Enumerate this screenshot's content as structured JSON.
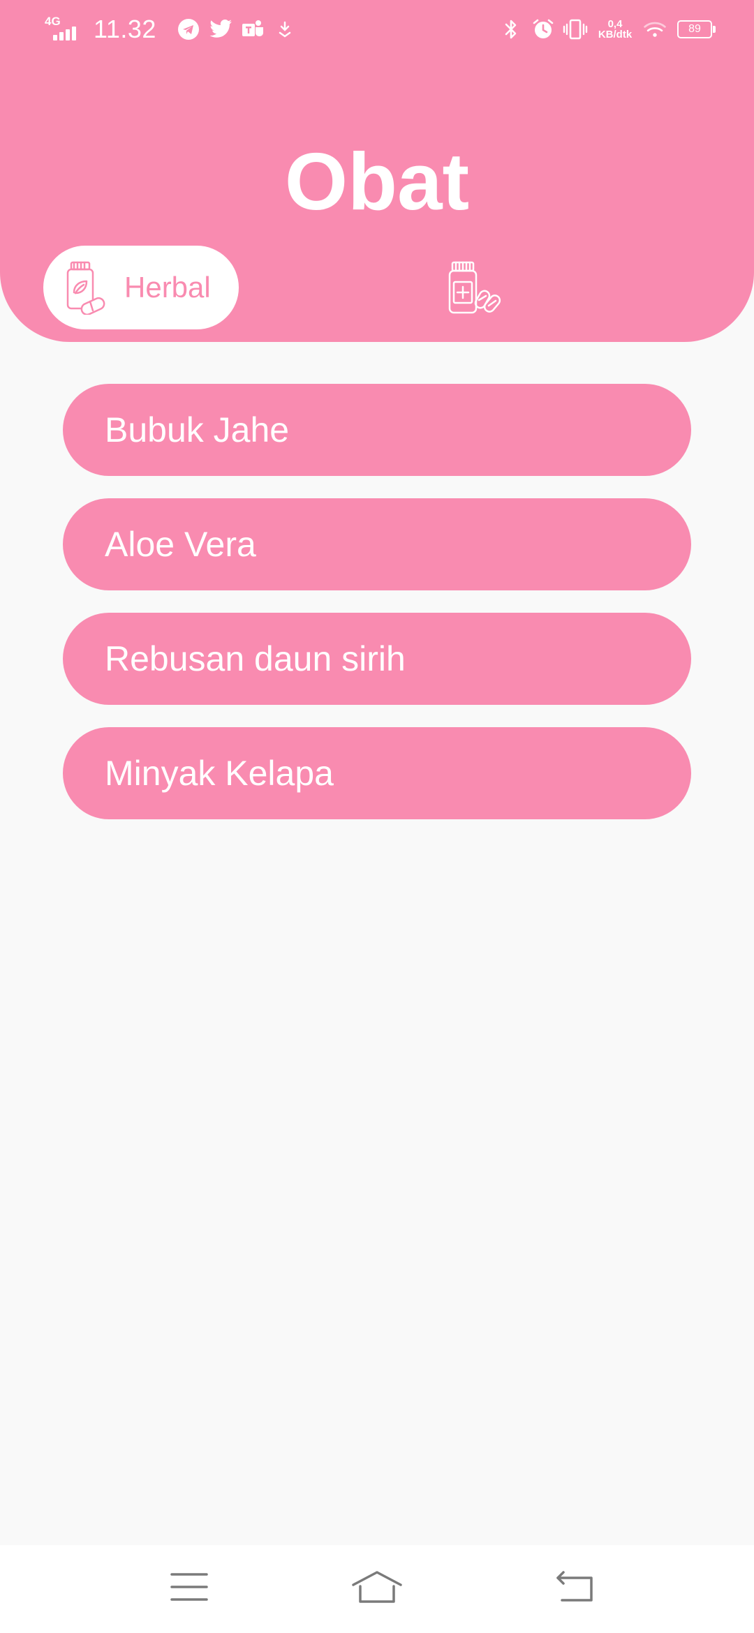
{
  "status_bar": {
    "network_type": "4G",
    "time": "11.32",
    "notification_icons": [
      "telegram-icon",
      "twitter-icon",
      "teams-icon",
      "download-icon"
    ],
    "system_icons": [
      "bluetooth-icon",
      "alarm-icon",
      "vibrate-icon",
      "wifi-icon"
    ],
    "net_speed_value": "0,4",
    "net_speed_unit": "KB/dtk",
    "battery_level": "89"
  },
  "header": {
    "title": "Obat",
    "tabs": [
      {
        "label": "Herbal",
        "icon": "herbal-bottle-icon",
        "selected": true
      },
      {
        "label": "",
        "icon": "medicine-bottle-icon",
        "selected": false
      }
    ]
  },
  "list": {
    "items": [
      {
        "label": "Bubuk Jahe"
      },
      {
        "label": "Aloe Vera"
      },
      {
        "label": "Rebusan daun sirih"
      },
      {
        "label": "Minyak Kelapa"
      }
    ]
  },
  "nav_bar": {
    "buttons": [
      "menu-icon",
      "home-icon",
      "back-icon"
    ]
  },
  "colors": {
    "accent": "#f98bb0",
    "background": "#f9f9f9",
    "on_accent": "#ffffff",
    "nav_icon": "#7a7a7a"
  }
}
